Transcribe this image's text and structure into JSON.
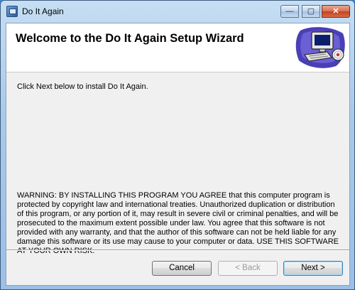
{
  "window": {
    "title": "Do It Again",
    "controls": {
      "minimize": "—",
      "maximize": "▢",
      "close": "✕"
    }
  },
  "header": {
    "title": "Welcome to the Do It Again Setup Wizard",
    "graphic": "computer-setup-icon"
  },
  "body": {
    "intro": "Click Next below to install Do It Again.",
    "warning": "WARNING: BY INSTALLING THIS PROGRAM YOU AGREE that this computer program is protected by copyright law and international treaties. Unauthorized duplication or distribution of this program, or any portion of it, may result in severe civil or criminal penalties, and will be prosecuted to the maximum extent possible under law. You agree that this software is not provided with any warranty, and that the author of this software can not be held liable for any damage this software or its use may cause to your computer or data. USE THIS SOFTWARE AT YOUR OWN RISK."
  },
  "buttons": {
    "cancel": "Cancel",
    "back": "< Back",
    "next": "Next >"
  }
}
